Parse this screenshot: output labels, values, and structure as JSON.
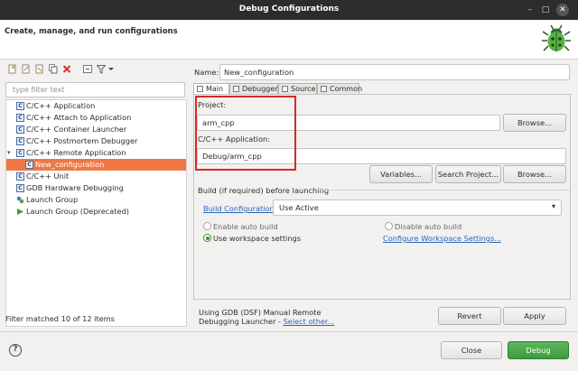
{
  "window": {
    "title": "Debug Configurations",
    "minimize_glyph": "–",
    "maximize_glyph": "□",
    "close_glyph": "✕"
  },
  "header": {
    "message": "Create, manage, and run configurations",
    "icon": "bug-icon"
  },
  "left": {
    "filter_placeholder": "type filter text",
    "tree": [
      {
        "label": "C/C++ Application",
        "icon": "c-config-icon"
      },
      {
        "label": "C/C++ Attach to Application",
        "icon": "c-config-icon"
      },
      {
        "label": "C/C++ Container Launcher",
        "icon": "c-config-icon"
      },
      {
        "label": "C/C++ Postmortem Debugger",
        "icon": "c-config-icon"
      },
      {
        "label": "C/C++ Remote Application",
        "icon": "c-config-icon",
        "expanded": true
      },
      {
        "label": "New_configuration",
        "icon": "c-config-icon",
        "selected": true
      },
      {
        "label": "C/C++ Unit",
        "icon": "c-config-icon"
      },
      {
        "label": "GDB Hardware Debugging",
        "icon": "c-config-icon"
      },
      {
        "label": "Launch Group",
        "icon": "launch-group-icon"
      },
      {
        "label": "Launch Group (Deprecated)",
        "icon": "launch-group-deprecated-icon"
      }
    ],
    "status": "Filter matched 10 of 12 items",
    "twisty_glyph": "▾",
    "c_glyph": "C"
  },
  "right": {
    "name_label": "Name:",
    "name_value": "New_configuration",
    "tabs": [
      {
        "label": "Main",
        "active": true
      },
      {
        "label": "Debugger"
      },
      {
        "label": "Source"
      },
      {
        "label": "Common"
      }
    ],
    "project_label": "Project:",
    "project_value": "arm_cpp",
    "browse_label": "Browse...",
    "app_label": "C/C++ Application:",
    "app_value": "Debug/arm_cpp",
    "variables_label": "Variables...",
    "search_project_label": "Search Project...",
    "build_group_label": "Build (if required) before launching",
    "build_config_link": "Build Configuration:",
    "build_config_value": "Use Active",
    "combo_arrow": "▾",
    "enable_auto_build": "Enable auto build",
    "disable_auto_build": "Disable auto build",
    "use_workspace_settings": "Use workspace settings",
    "configure_workspace_link": "Configure Workspace Settings...",
    "launcher_text": "Using GDB (DSF) Manual Remote Debugging Launcher - ",
    "select_other_link": "Select other...",
    "revert_label": "Revert",
    "apply_label": "Apply"
  },
  "footer": {
    "help_glyph": "?",
    "close_label": "Close",
    "debug_label": "Debug"
  },
  "colors": {
    "accent_selection": "#f07746",
    "debug_button": "#4aa84a",
    "highlight_box": "#d52a2a",
    "link": "#2966b8"
  }
}
